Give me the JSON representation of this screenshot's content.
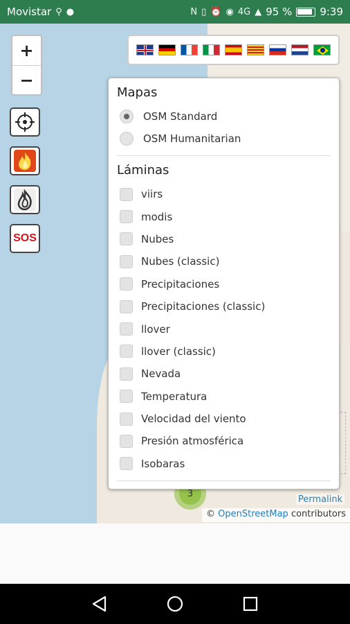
{
  "status_bar": {
    "carrier": "Movistar",
    "battery_percent": "95 %",
    "time": "9:39",
    "signal_label": "4G"
  },
  "map": {
    "zoom_in": "+",
    "zoom_out": "−",
    "sos_label": "SOS",
    "cluster_count": "3",
    "permalink": "Permalink",
    "attribution_prefix": "©",
    "attribution_link": "OpenStreetMap",
    "attribution_suffix": "contributors"
  },
  "flags": [
    "gb-flag-icon",
    "de-flag-icon",
    "fr-flag-icon",
    "it-flag-icon",
    "es-flag-icon",
    "ca-flag-icon",
    "ru-flag-icon",
    "nl-flag-icon",
    "br-flag-icon"
  ],
  "layers_panel": {
    "base_title": "Mapas",
    "base_layers": [
      {
        "label": "OSM Standard",
        "checked": true
      },
      {
        "label": "OSM Humanitarian",
        "checked": false
      }
    ],
    "overlay_title": "Láminas",
    "overlays": [
      {
        "label": "viirs",
        "checked": false
      },
      {
        "label": "modis",
        "checked": false
      },
      {
        "label": "Nubes",
        "checked": false
      },
      {
        "label": "Nubes (classic)",
        "checked": false
      },
      {
        "label": "Precipitaciones",
        "checked": false
      },
      {
        "label": "Precipitaciones (classic)",
        "checked": false
      },
      {
        "label": "llover",
        "checked": false
      },
      {
        "label": "llover (classic)",
        "checked": false
      },
      {
        "label": "Nevada",
        "checked": false
      },
      {
        "label": "Temperatura",
        "checked": false
      },
      {
        "label": "Velocidad del viento",
        "checked": false
      },
      {
        "label": "Presión atmosférica",
        "checked": false
      },
      {
        "label": "Isobaras",
        "checked": false
      }
    ]
  },
  "colors": {
    "status_bar": "#2e7d4f",
    "sea": "#b6d4e6",
    "link": "#1f7fbd",
    "sos_red": "#d0141c"
  }
}
